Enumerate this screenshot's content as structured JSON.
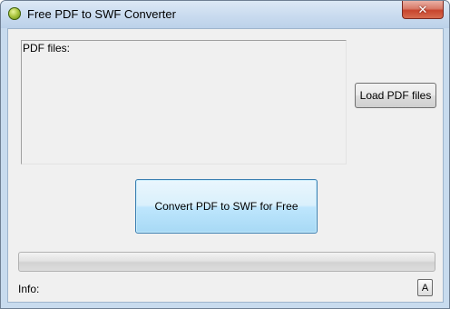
{
  "window": {
    "title": "Free PDF to SWF Converter",
    "close_label": "✕"
  },
  "file_list": {
    "label": "PDF files:",
    "items": []
  },
  "buttons": {
    "load_label": "Load PDF files",
    "convert_label": "Convert PDF to SWF for Free",
    "font_label": "A"
  },
  "progress": {
    "value": 0
  },
  "status": {
    "info_label": "Info:",
    "info_text": ""
  }
}
